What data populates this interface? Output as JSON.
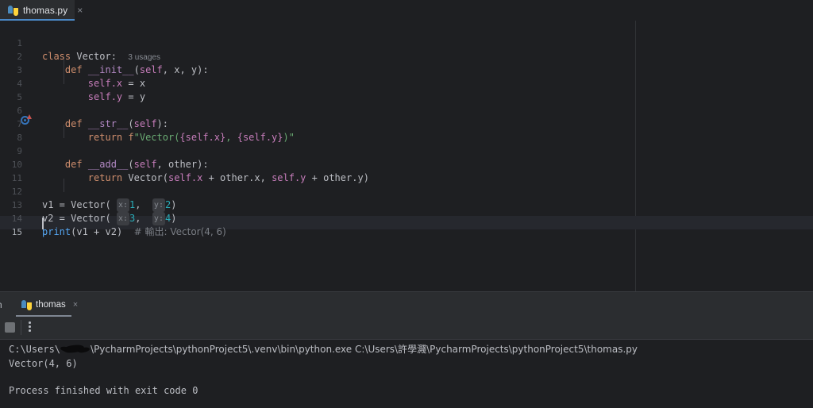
{
  "theme": {
    "editor_bg": "#1e1f22",
    "panel_bg": "#2b2d30",
    "text": "#bcbec4",
    "accent": "#4a88c7",
    "keyword": "#cf8e6d",
    "function": "#56a8f5",
    "magic_method": "#b389c5",
    "self_param": "#c77dbb",
    "number": "#2aacb8",
    "string": "#6aab73",
    "comment": "#7a7e85",
    "line_number": "#4e5157"
  },
  "editor_tabs": [
    {
      "label": "thomas.py",
      "icon": "python-file-icon",
      "close": "×",
      "active": true
    }
  ],
  "editor": {
    "current_line": 15,
    "usages_hint": "3 usages",
    "gutter_icon_line6": "overridden-method-icon",
    "lines": [
      {
        "n": 1,
        "text": "class Vector:"
      },
      {
        "n": 2,
        "text": "    def __init__(self, x, y):"
      },
      {
        "n": 3,
        "text": "        self.x = x"
      },
      {
        "n": 4,
        "text": "        self.y = y"
      },
      {
        "n": 5,
        "text": ""
      },
      {
        "n": 6,
        "text": "    def __str__(self):"
      },
      {
        "n": 7,
        "text": "        return f\"Vector({self.x}, {self.y})\""
      },
      {
        "n": 8,
        "text": ""
      },
      {
        "n": 9,
        "text": "    def __add__(self, other):"
      },
      {
        "n": 10,
        "text": "        return Vector(self.x + other.x, self.y + other.y)"
      },
      {
        "n": 11,
        "text": ""
      },
      {
        "n": 12,
        "text": "v1 = Vector( x: 1,  y: 2)"
      },
      {
        "n": 13,
        "text": "v2 = Vector( x: 3,  y: 4)"
      },
      {
        "n": 14,
        "text": "print(v1 + v2)  # 輸出: Vector(4, 6)"
      },
      {
        "n": 15,
        "text": ""
      }
    ],
    "tokens": {
      "kw_class": "class",
      "kw_def": "def",
      "kw_return": "return",
      "name_vector": "Vector",
      "colon": ":",
      "m_init": "__init__",
      "m_str": "__str__",
      "m_add": "__add__",
      "p_self": "self",
      "p_x": "x",
      "p_y": "y",
      "p_other": "other",
      "self_x": "self.x",
      "self_y": "self.y",
      "other_x": "other.x",
      "other_y": "other.y",
      "assign": " = ",
      "fstring_prefix": "f",
      "fstring_open": "\"Vector(",
      "fstring_mid": ", ",
      "fstring_close": ")\"",
      "brace_open": "{",
      "brace_close": "}",
      "plus": " + ",
      "v1": "v1",
      "v2": "v2",
      "print": "print",
      "comment": "# 輸出: Vector(4, 6)",
      "hint_x": "x:",
      "hint_y": "y:",
      "num1": "1",
      "num2": "2",
      "num3": "3",
      "num4": "4"
    }
  },
  "run_panel": {
    "tool_window_label": "n",
    "tabs": [
      {
        "label": "thomas",
        "icon": "python-run-icon",
        "close": "×",
        "active": true
      }
    ],
    "toolbar": {
      "stop_button": "Stop",
      "more_button": "More options"
    },
    "console_lines": [
      {
        "kind": "command",
        "prefix": "C:\\Users\\",
        "redacted": true,
        "suffix": "\\PycharmProjects\\pythonProject5\\.venv\\bin\\python.exe C:\\Users\\許學濺\\PycharmProjects\\pythonProject5\\thomas.py"
      },
      {
        "kind": "output",
        "text": "Vector(4, 6)"
      },
      {
        "kind": "blank",
        "text": ""
      },
      {
        "kind": "status",
        "text": "Process finished with exit code 0"
      }
    ]
  }
}
